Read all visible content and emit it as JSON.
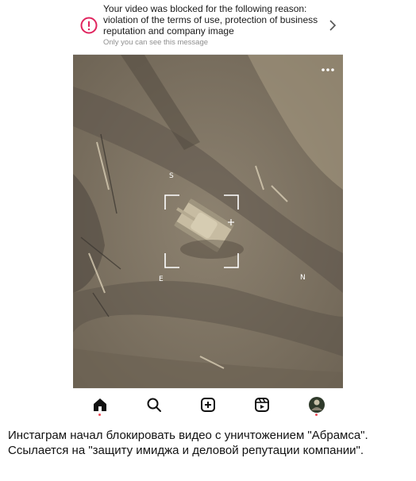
{
  "notice": {
    "icon": "alert-circle-icon",
    "message": "Your video was blocked for the following reason: violation of the terms of use, protection of business reputation and company image",
    "subtext": "Only you can see this message",
    "chevron_icon": "chevron-right-icon"
  },
  "video": {
    "description": "aerial drone footage of a tank",
    "more_icon": "more-dots-icon"
  },
  "tabbar": {
    "items": [
      {
        "name": "home",
        "icon": "home-icon",
        "active": true
      },
      {
        "name": "search",
        "icon": "search-icon"
      },
      {
        "name": "create",
        "icon": "plus-square-icon"
      },
      {
        "name": "reels",
        "icon": "reels-icon"
      },
      {
        "name": "profile",
        "icon": "avatar-icon"
      }
    ],
    "badge_color": "#ed4956"
  },
  "caption": "Инстаграм начал блокировать видео с уничтожением \"Абрамса\". Ссылается на \"защиту имиджа и деловой репутации компании\"."
}
